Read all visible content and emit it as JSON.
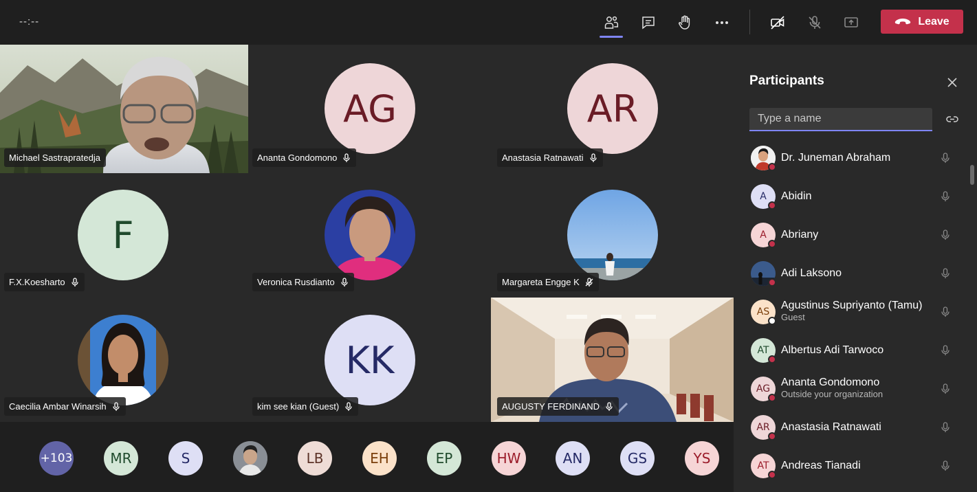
{
  "topbar": {
    "timer": "--:--",
    "leave_label": "Leave",
    "buttons": [
      {
        "icon": "people-icon",
        "label": "Show participants"
      },
      {
        "icon": "chat-icon",
        "label": "Show conversation"
      },
      {
        "icon": "raise-hand-icon",
        "label": "Raise hand"
      },
      {
        "icon": "more-icon",
        "label": "More actions"
      },
      {
        "icon": "camera-off-icon",
        "label": "Turn camera on"
      },
      {
        "icon": "mic-off-icon",
        "label": "Unmute"
      },
      {
        "icon": "share-icon",
        "label": "Share content"
      }
    ]
  },
  "tiles": [
    {
      "name": "Michael Sastrapratedja",
      "type": "video"
    },
    {
      "name": "Ananta Gondomono",
      "initials": "AG"
    },
    {
      "name": "Anastasia Ratnawati",
      "initials": "AR"
    },
    {
      "name": "F.X.Koesharto",
      "initials": "F"
    },
    {
      "name": "Veronica Rusdianto",
      "type": "photo"
    },
    {
      "name": "Margareta Engge K",
      "type": "photo"
    },
    {
      "name": "Caecilia Ambar Winarsih",
      "type": "photo"
    },
    {
      "name": "kim see kian (Guest)",
      "initials": "KK"
    },
    {
      "name": "AUGUSTY FERDINAND",
      "type": "video"
    }
  ],
  "strip": [
    {
      "label": "+103"
    },
    {
      "label": "MR"
    },
    {
      "label": "S"
    },
    {
      "label": ""
    },
    {
      "label": "LB"
    },
    {
      "label": "EH"
    },
    {
      "label": "EP"
    },
    {
      "label": "HW"
    },
    {
      "label": "AN"
    },
    {
      "label": "GS"
    },
    {
      "label": "YS"
    }
  ],
  "panel": {
    "title": "Participants",
    "search_placeholder": "Type a name",
    "participants": [
      {
        "name": "Dr. Juneman Abraham",
        "initials": "",
        "sub": ""
      },
      {
        "name": "Abidin",
        "initials": "A",
        "sub": ""
      },
      {
        "name": "Abriany",
        "initials": "A",
        "sub": ""
      },
      {
        "name": "Adi Laksono",
        "initials": "",
        "sub": ""
      },
      {
        "name": "Agustinus Supriyanto (Tamu)",
        "initials": "AS",
        "sub": "Guest"
      },
      {
        "name": "Albertus Adi Tarwoco",
        "initials": "AT",
        "sub": ""
      },
      {
        "name": "Ananta Gondomono",
        "initials": "AG",
        "sub": "Outside your organization"
      },
      {
        "name": "Anastasia Ratnawati",
        "initials": "AR",
        "sub": ""
      },
      {
        "name": "Andreas Tianadi",
        "initials": "AT",
        "sub": ""
      }
    ]
  },
  "colors": {
    "accent": "#7f85f5",
    "leave": "#c4314b",
    "status_busy": "#c4314b"
  }
}
